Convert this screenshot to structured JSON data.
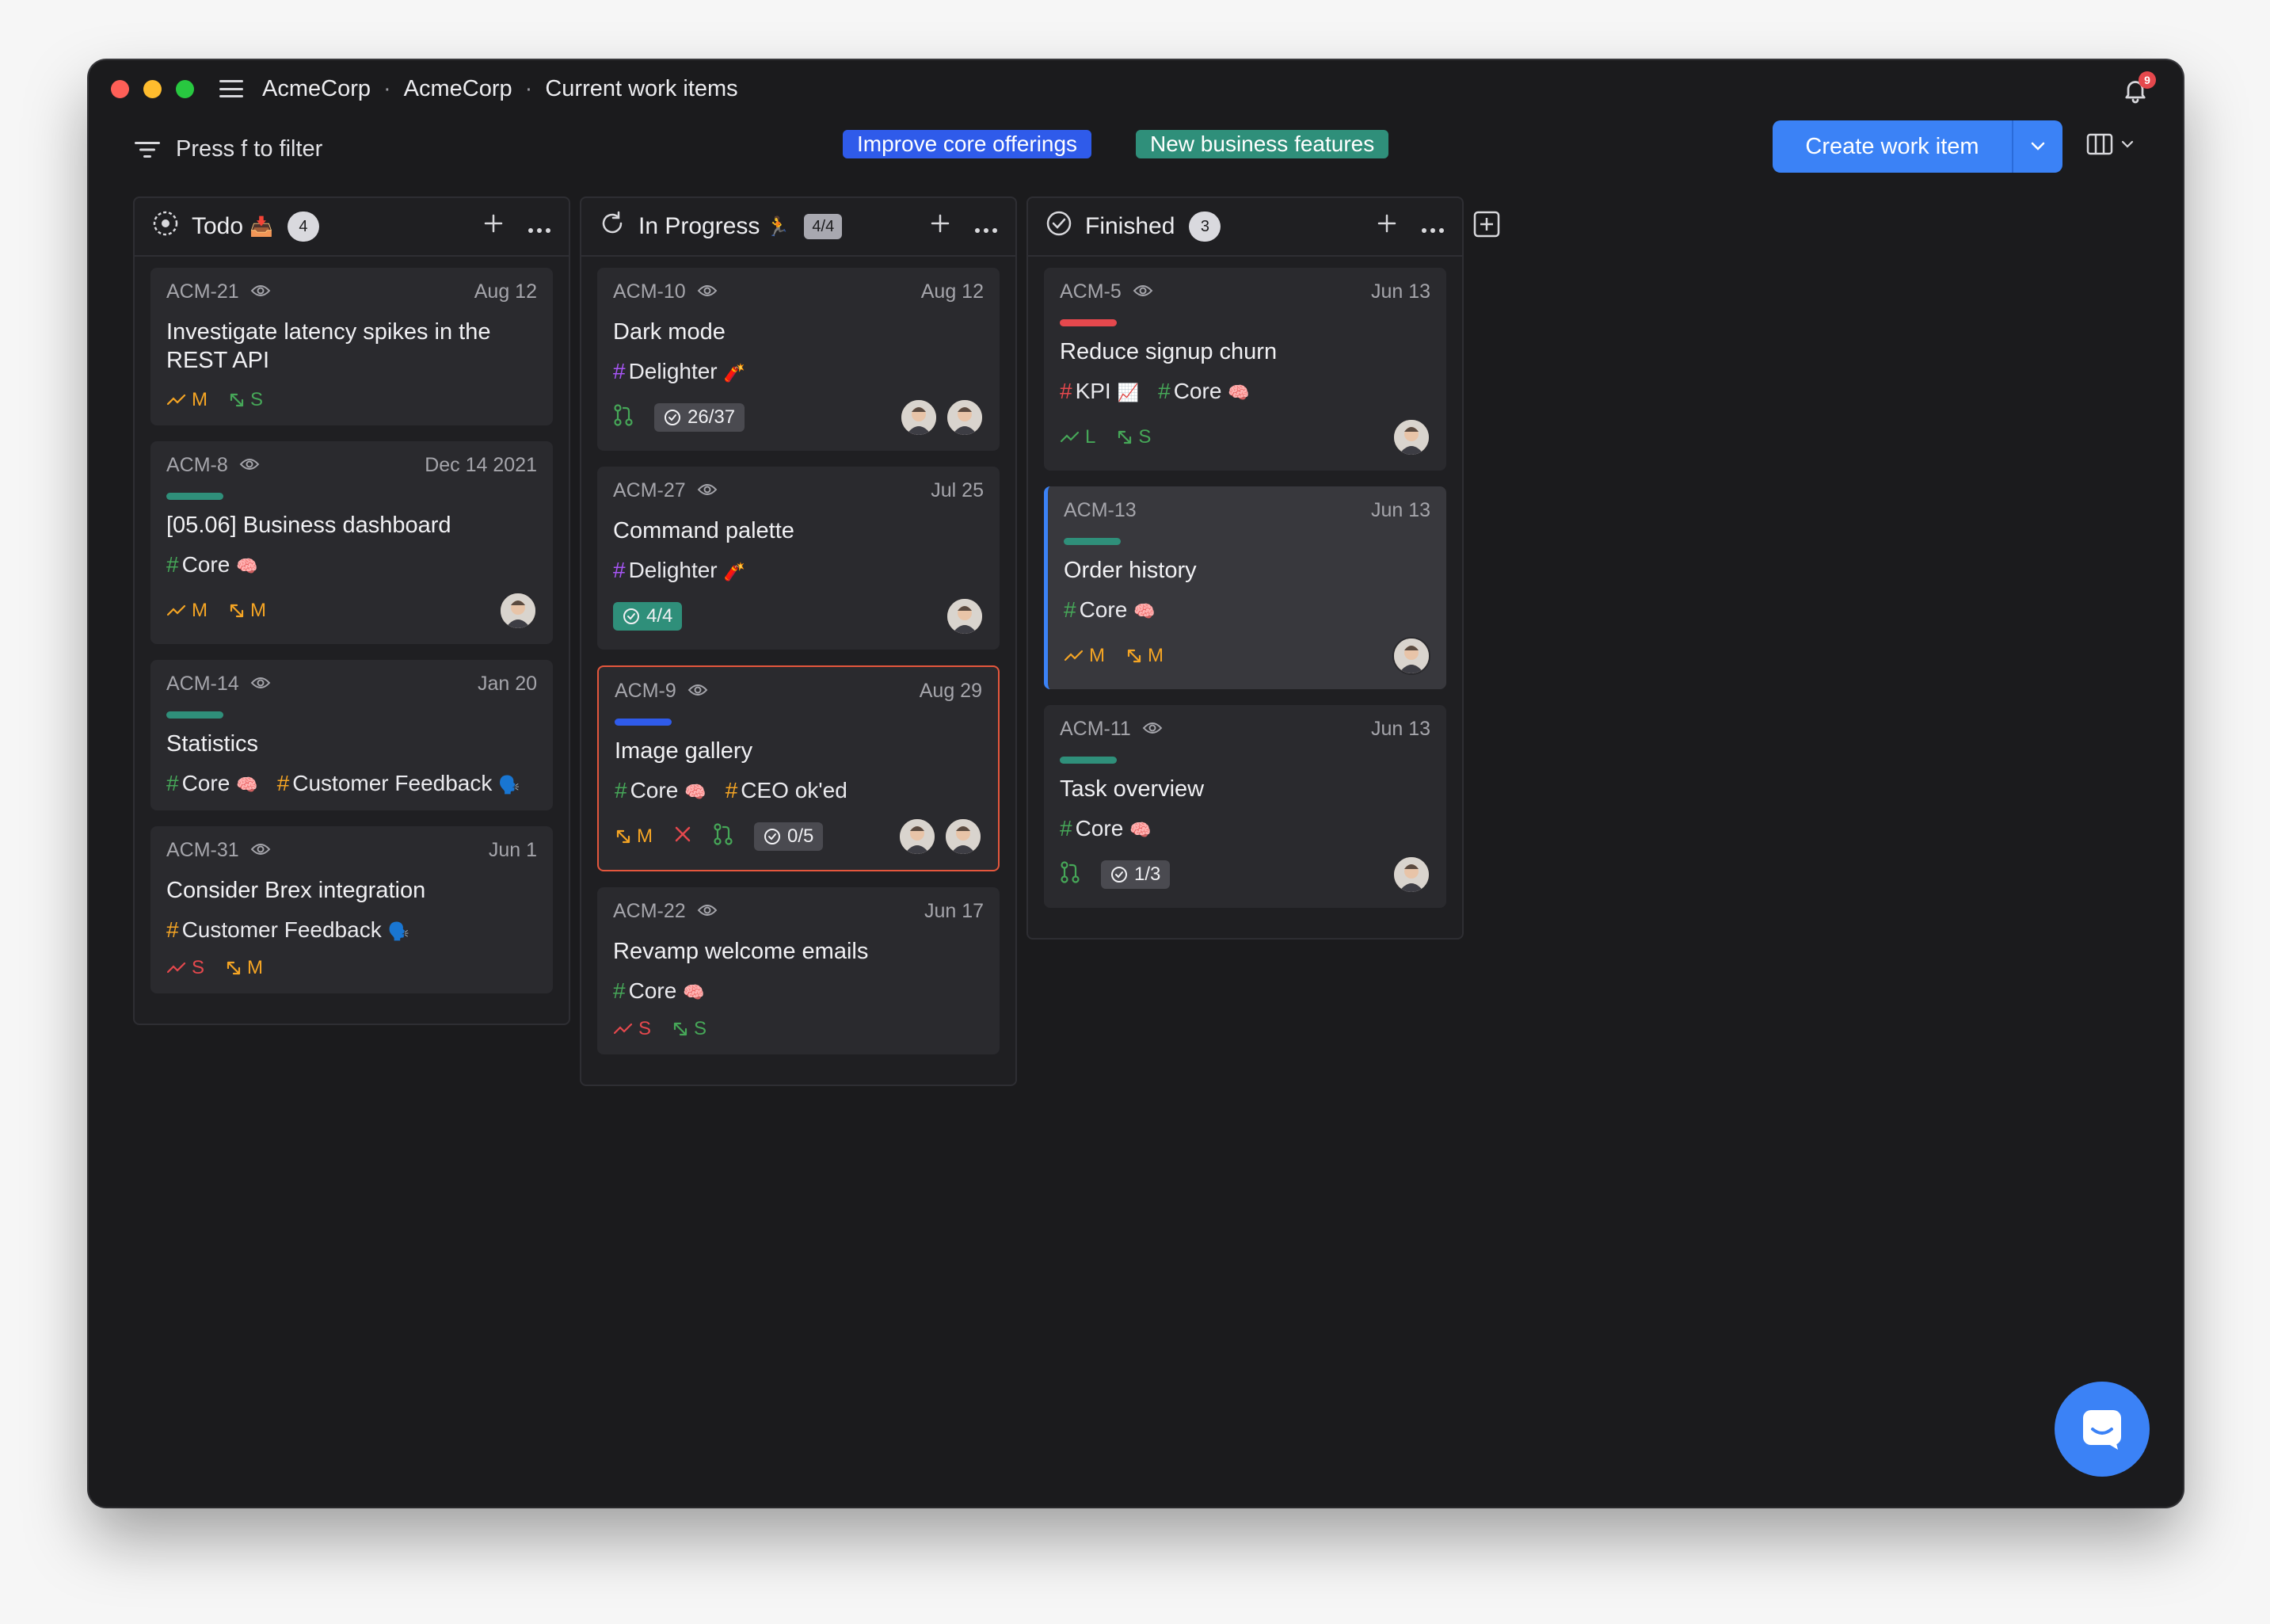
{
  "breadcrumb": [
    "AcmeCorp",
    "AcmeCorp",
    "Current work items"
  ],
  "notifications": {
    "count": "9"
  },
  "filter": {
    "placeholder": "Press f to filter"
  },
  "projects": [
    "Improve core offerings",
    "New business features"
  ],
  "create_button": {
    "label": "Create work item"
  },
  "colors": {
    "accent": "#3b82f6",
    "core": "#2f8f7a",
    "improve": "#2f5bea",
    "urgent": "#e5484d",
    "selected": "#e4573d"
  },
  "columns": [
    {
      "name": "Todo",
      "emoji": "📥",
      "count": "4",
      "status_icon": "todo-circle-icon",
      "cards": [
        {
          "id": "ACM-21",
          "date": "Aug 12",
          "title": "Investigate latency spikes in the REST API",
          "labels": [],
          "trend": "M",
          "trend_color": "#f5a524",
          "size": "S",
          "size_color": "#46a758"
        },
        {
          "id": "ACM-8",
          "date": "Dec 14 2021",
          "bar": "#2f8f7a",
          "title": "[05.06] Business dashboard",
          "labels": [
            {
              "name": "Core",
              "hash_color": "#46a758",
              "emoji": "🧠"
            }
          ],
          "trend": "M",
          "trend_color": "#f5a524",
          "size": "M",
          "size_color": "#f5a524",
          "avatars": 1
        },
        {
          "id": "ACM-14",
          "date": "Jan 20",
          "bar": "#2f8f7a",
          "title": "Statistics",
          "labels": [
            {
              "name": "Core",
              "hash_color": "#46a758",
              "emoji": "🧠"
            },
            {
              "name": "Customer Feedback",
              "hash_color": "#f5a524",
              "emoji": "🗣️"
            }
          ]
        },
        {
          "id": "ACM-31",
          "date": "Jun 1",
          "title": "Consider Brex integration",
          "labels": [
            {
              "name": "Customer Feedback",
              "hash_color": "#f5a524",
              "emoji": "🗣️"
            }
          ],
          "trend": "S",
          "trend_color": "#e5484d",
          "size": "M",
          "size_color": "#f5a524"
        }
      ]
    },
    {
      "name": "In Progress",
      "emoji": "🏃",
      "count": "4/4",
      "status_icon": "in-progress-icon",
      "cards": [
        {
          "id": "ACM-10",
          "date": "Aug 12",
          "title": "Dark mode",
          "labels": [
            {
              "name": "Delighter",
              "hash_color": "#a855f7",
              "emoji": "🧨"
            }
          ],
          "pr": true,
          "check": "26/37",
          "avatars": 2
        },
        {
          "id": "ACM-27",
          "date": "Jul 25",
          "title": "Command palette",
          "labels": [
            {
              "name": "Delighter",
              "hash_color": "#a855f7",
              "emoji": "🧨"
            }
          ],
          "check": "4/4",
          "check_done": true,
          "avatars": 1
        },
        {
          "id": "ACM-9",
          "date": "Aug 29",
          "bar": "#2f5bea",
          "title": "Image gallery",
          "labels": [
            {
              "name": "Core",
              "hash_color": "#46a758",
              "emoji": "🧠"
            },
            {
              "name": "CEO ok'ed",
              "hash_color": "#f5a524",
              "emoji": ""
            }
          ],
          "size": "M",
          "size_color": "#f5a524",
          "cross": true,
          "pr": true,
          "check": "0/5",
          "avatars": 2,
          "selected": true
        },
        {
          "id": "ACM-22",
          "date": "Jun 17",
          "title": "Revamp welcome emails",
          "labels": [
            {
              "name": "Core",
              "hash_color": "#46a758",
              "emoji": "🧠"
            }
          ],
          "trend": "S",
          "trend_color": "#e5484d",
          "size": "S",
          "size_color": "#46a758"
        }
      ]
    },
    {
      "name": "Finished",
      "emoji": "",
      "count": "3",
      "status_icon": "finished-check-icon",
      "cards": [
        {
          "id": "ACM-5",
          "date": "Jun 13",
          "bar": "#e5484d",
          "title": "Reduce signup churn",
          "labels": [
            {
              "name": "KPI",
              "hash_color": "#e5484d",
              "emoji": "📈"
            },
            {
              "name": "Core",
              "hash_color": "#46a758",
              "emoji": "🧠"
            }
          ],
          "trend": "L",
          "trend_color": "#46a758",
          "size": "S",
          "size_color": "#46a758",
          "avatars": 1
        },
        {
          "id": "ACM-13",
          "date": "Jun 13",
          "bar": "#2f8f7a",
          "title": "Order history",
          "labels": [
            {
              "name": "Core",
              "hash_color": "#46a758",
              "emoji": "🧠"
            }
          ],
          "trend": "M",
          "trend_color": "#f5a524",
          "size": "M",
          "size_color": "#f5a524",
          "avatars": 1,
          "highlight": true
        },
        {
          "id": "ACM-11",
          "date": "Jun 13",
          "bar": "#2f8f7a",
          "title": "Task overview",
          "labels": [
            {
              "name": "Core",
              "hash_color": "#46a758",
              "emoji": "🧠"
            }
          ],
          "pr": true,
          "check": "1/3",
          "avatars": 1
        }
      ]
    }
  ]
}
